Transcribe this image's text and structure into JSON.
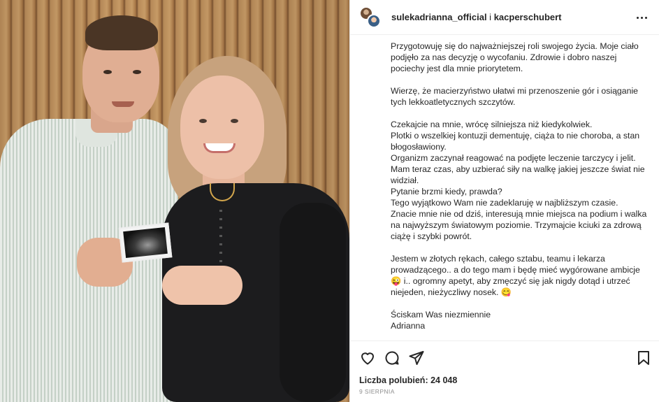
{
  "post": {
    "photo": {
      "alt": ""
    },
    "header": {
      "author_primary": "sulekadrianna_official",
      "separator": " i ",
      "author_secondary": "kacperschubert"
    },
    "caption": {
      "paragraphs": [
        "Przygotowuję się do najważniejszej roli swojego życia. Moje ciało podjęło za nas decyzję o wycofaniu. Zdrowie i dobro naszej pociechy jest dla mnie priorytetem.",
        "Wierzę, że macierzyństwo ułatwi mi przenoszenie gór i osiąganie tych lekkoatletycznych szczytów.",
        "Czekajcie na mnie, wrócę silniejsza niż kiedykolwiek.\nPlotki o wszelkiej kontuzji dementuję, ciąża to nie choroba, a stan błogosławiony.\nOrganizm zaczynał reagować na podjęte leczenie tarczycy i jelit. Mam teraz czas, aby uzbierać siły na walkę jakiej jeszcze świat nie widział.\nPytanie brzmi kiedy, prawda?\nTego wyjątkowo Wam nie zadeklaruję w najbliższym czasie.\nZnacie mnie nie od dziś, interesują mnie miejsca na podium i walka na najwyższym światowym poziomie. Trzymajcie kciuki za zdrową ciążę i szybki powrót.",
        "Jestem w złotych rękach, całego sztabu, teamu i lekarza prowadzącego.. a do tego mam i będę mieć wygórowane ambicje 😜 i.. ogromny apetyt, aby zmęczyć się jak nigdy dotąd i utrzeć niejeden, nieżyczliwy nosek. 😋",
        "Ściskam Was niezmiennie\nAdrianna"
      ]
    },
    "actions": {
      "like_icon": "heart-icon",
      "comment_icon": "comment-icon",
      "share_icon": "share-icon",
      "save_icon": "bookmark-icon"
    },
    "likes_text": "Liczba polubień: 24 048",
    "date_text": "9 SIERPNIA"
  }
}
